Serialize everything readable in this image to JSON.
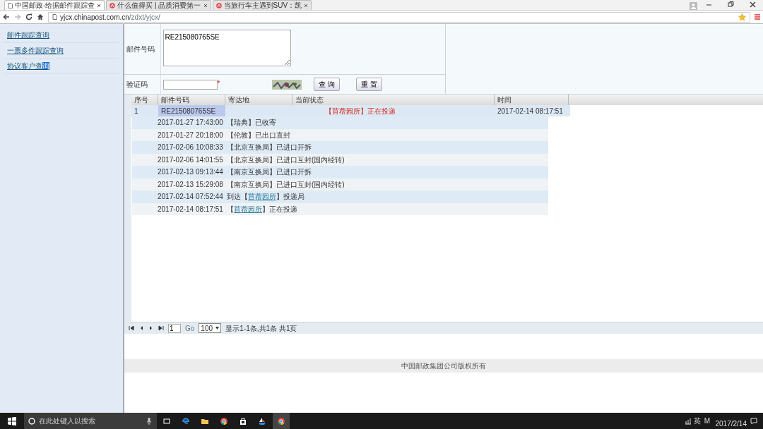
{
  "browser": {
    "tabs": [
      {
        "label": "中国邮政-给据邮件跟踪查",
        "selected": true,
        "kind": "page"
      },
      {
        "label": "什么值得买 | 品质消费第一",
        "selected": false,
        "kind": "site"
      },
      {
        "label": "当旅行车主遇到SUV：凯",
        "selected": false,
        "kind": "site"
      }
    ],
    "address": {
      "host": "yjcx.chinapost.com.cn",
      "path": "/zdxt/yjcx/"
    }
  },
  "sidebar": {
    "items": [
      {
        "label": "邮件跟踪查询"
      },
      {
        "label": "一票多件跟踪查询"
      },
      {
        "label": "协议客户查",
        "highlight": "询"
      }
    ]
  },
  "form": {
    "mail_label": "邮件号码",
    "mail_value": "RE215080765SE",
    "captcha_label": "验证码",
    "required_mark": "*",
    "buttons": [
      "查 询",
      "重 置"
    ]
  },
  "grid": {
    "columns": [
      "序号",
      "邮件号码",
      "寄达地",
      "当前状态",
      "时间"
    ],
    "row": {
      "index": "1",
      "number": "RE215080765SE",
      "destination_status": "【苜蓿园所】正在投递",
      "time": "2017-02-14 08:17:51"
    },
    "details": [
      {
        "time": "2017-01-27 17:43:00",
        "status": "【瑞典】已收寄"
      },
      {
        "time": "2017-01-27 20:18:00",
        "status": "【伦敦】已出口直封"
      },
      {
        "time": "2017-02-06 10:08:33",
        "status": "【北京互换局】已进口开拆"
      },
      {
        "time": "2017-02-06 14:01:55",
        "status": "【北京互换局】已进口互封(国内经转)"
      },
      {
        "time": "2017-02-13 09:13:44",
        "status": "【南京互换局】已进口开拆"
      },
      {
        "time": "2017-02-13 15:29:08",
        "status": "【南京互换局】已进口互封(国内经转)"
      },
      {
        "time": "2017-02-14 07:52:44",
        "status": "到达【",
        "place": "苜蓿园所",
        "after": "】投递局"
      },
      {
        "time": "2017-02-14 08:17:51",
        "status": "【",
        "place": "苜蓿园所",
        "after": "】正在投递"
      }
    ]
  },
  "pager": {
    "page": "1",
    "go": "Go",
    "page_size": "100",
    "summary": "显示1-1条,共1条 共1页"
  },
  "footer": "中国邮政集团公司版权所有",
  "taskbar": {
    "search_placeholder": "在此处键入以搜索",
    "tray": [
      "英",
      "M"
    ],
    "date": "2017/2/14"
  }
}
